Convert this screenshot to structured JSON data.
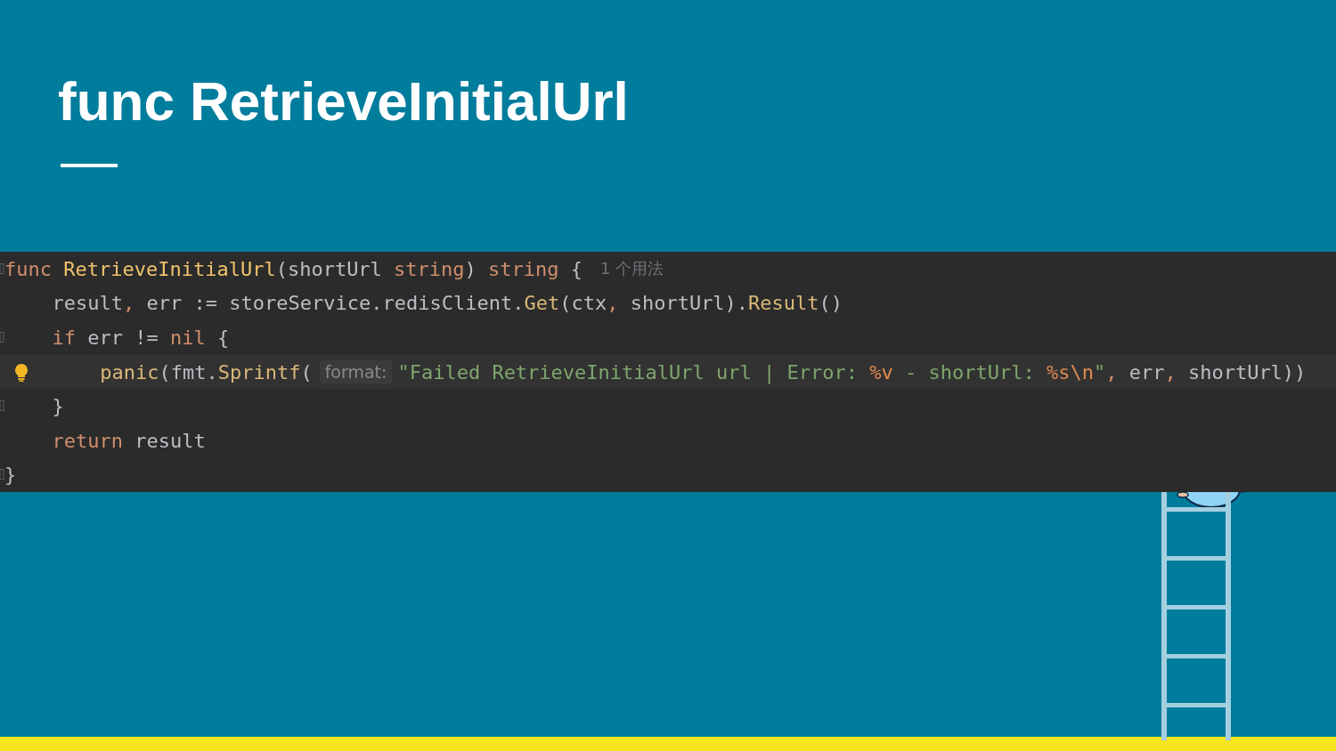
{
  "slide": {
    "title": "func RetrieveInitialUrl"
  },
  "code": {
    "lines": [
      {
        "current": false,
        "fold": true,
        "intention": false,
        "parts": [
          {
            "kind": "code",
            "tokens": [
              {
                "text": "func ",
                "kind": "keyword"
              },
              {
                "text": "RetrieveInitialUrl",
                "kind": "function"
              },
              {
                "text": "(shortUrl ",
                "kind": "plain"
              },
              {
                "text": "string",
                "kind": "keyword"
              },
              {
                "text": ") ",
                "kind": "plain"
              },
              {
                "text": "string",
                "kind": "keyword"
              },
              {
                "text": " {",
                "kind": "plain"
              }
            ]
          },
          {
            "kind": "usage",
            "text": "1 个用法"
          }
        ],
        "children": [
          {
            "current": false,
            "fold": false,
            "intention": false,
            "parts": [
              {
                "kind": "code",
                "tokens": [
                  {
                    "text": "result",
                    "kind": "plain"
                  },
                  {
                    "text": ", ",
                    "kind": "punct"
                  },
                  {
                    "text": "err := storeService.redisClient.",
                    "kind": "plain"
                  },
                  {
                    "text": "Get",
                    "kind": "method"
                  },
                  {
                    "text": "(ctx",
                    "kind": "plain"
                  },
                  {
                    "text": ", ",
                    "kind": "punct"
                  },
                  {
                    "text": "shortUrl).",
                    "kind": "plain"
                  },
                  {
                    "text": "Result",
                    "kind": "method"
                  },
                  {
                    "text": "()",
                    "kind": "plain"
                  }
                ]
              }
            ]
          },
          {
            "current": false,
            "fold": true,
            "intention": false,
            "parts": [
              {
                "kind": "code",
                "tokens": [
                  {
                    "text": "if ",
                    "kind": "keyword"
                  },
                  {
                    "text": "err != ",
                    "kind": "plain"
                  },
                  {
                    "text": "nil",
                    "kind": "keyword"
                  },
                  {
                    "text": " {",
                    "kind": "plain"
                  }
                ]
              }
            ],
            "children": [
              {
                "current": true,
                "fold": false,
                "intention": true,
                "parts": [
                  {
                    "kind": "code",
                    "tokens": [
                      {
                        "text": "panic",
                        "kind": "method"
                      },
                      {
                        "text": "(fmt.",
                        "kind": "plain"
                      },
                      {
                        "text": "Sprintf",
                        "kind": "method"
                      },
                      {
                        "text": "(",
                        "kind": "plain"
                      }
                    ]
                  },
                  {
                    "kind": "hint",
                    "text": "format:"
                  },
                  {
                    "kind": "code",
                    "tokens": [
                      {
                        "text": "\"Failed RetrieveInitialUrl url | Error: ",
                        "kind": "string"
                      },
                      {
                        "text": "%v",
                        "kind": "format"
                      },
                      {
                        "text": " - shortUrl: ",
                        "kind": "string"
                      },
                      {
                        "text": "%s\\n",
                        "kind": "format"
                      },
                      {
                        "text": "\"",
                        "kind": "string"
                      },
                      {
                        "text": ", ",
                        "kind": "punct"
                      },
                      {
                        "text": "err",
                        "kind": "plain"
                      },
                      {
                        "text": ", ",
                        "kind": "punct"
                      },
                      {
                        "text": "shortUrl))",
                        "kind": "plain"
                      }
                    ]
                  }
                ]
              }
            ]
          },
          {
            "current": false,
            "fold": true,
            "intention": false,
            "parts": [
              {
                "kind": "code",
                "tokens": [
                  {
                    "text": "}",
                    "kind": "plain"
                  }
                ]
              }
            ]
          },
          {
            "current": false,
            "fold": false,
            "intention": false,
            "parts": [
              {
                "kind": "code",
                "tokens": [
                  {
                    "text": "return ",
                    "kind": "keyword"
                  },
                  {
                    "text": "result",
                    "kind": "plain"
                  }
                ]
              }
            ]
          }
        ]
      },
      {
        "current": false,
        "fold": true,
        "intention": false,
        "parts": [
          {
            "kind": "code",
            "tokens": [
              {
                "text": "}",
                "kind": "plain"
              }
            ]
          }
        ]
      }
    ]
  }
}
